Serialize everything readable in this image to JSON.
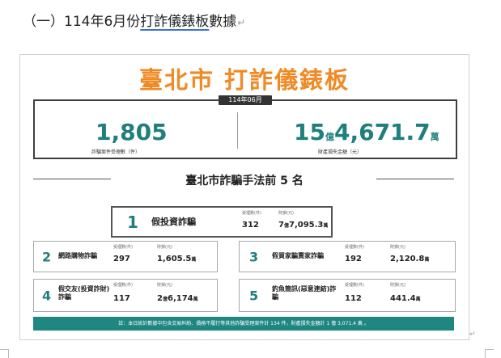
{
  "section_heading": {
    "prefix": "（一）114年6月份",
    "underlined": "打詐儀錶板",
    "suffix": "數據",
    "mark": "↵"
  },
  "poster": {
    "title": "臺北市 打詐儀錶板",
    "period": "114年06月",
    "cases": {
      "value": "1,805",
      "label": "詐騙案件受理數（件）"
    },
    "loss": {
      "yi": "15",
      "yi_unit": "億",
      "wan": "4,671.7",
      "wan_unit": "萬",
      "label": "財產損失金額（元）"
    },
    "ranking_title": "臺北市詐騙手法前 5 名",
    "col_cases": "受理數(件)",
    "col_loss": "財損(元)",
    "ranks": [
      {
        "rank": "1",
        "name": "假投資詐騙",
        "cases": "312",
        "loss_pre": "7",
        "loss_pre_unit": "億",
        "loss_num": "7,095.3",
        "loss_unit": "萬"
      },
      {
        "rank": "2",
        "name": "網路購物詐騙",
        "cases": "297",
        "loss_num": "1,605.5",
        "loss_unit": "萬"
      },
      {
        "rank": "3",
        "name": "假買家騙賣家詐騙",
        "cases": "192",
        "loss_num": "2,120.8",
        "loss_unit": "萬"
      },
      {
        "rank": "4",
        "name": "假交友(投資詐財)詐騙",
        "cases": "117",
        "loss_pre": "2",
        "loss_pre_unit": "億",
        "loss_num": "6,174",
        "loss_unit": "萬"
      },
      {
        "rank": "5",
        "name": "釣魚簡訊(惡意連結)詐騙",
        "cases": "112",
        "loss_num": "441.4",
        "loss_unit": "萬"
      }
    ],
    "footnote": "註：本日統計數據中包含交易糾紛、債務不履行等其他詐騙受理案件計 134 件，財產損失金額計 1 億 3,071.4 萬 。"
  }
}
